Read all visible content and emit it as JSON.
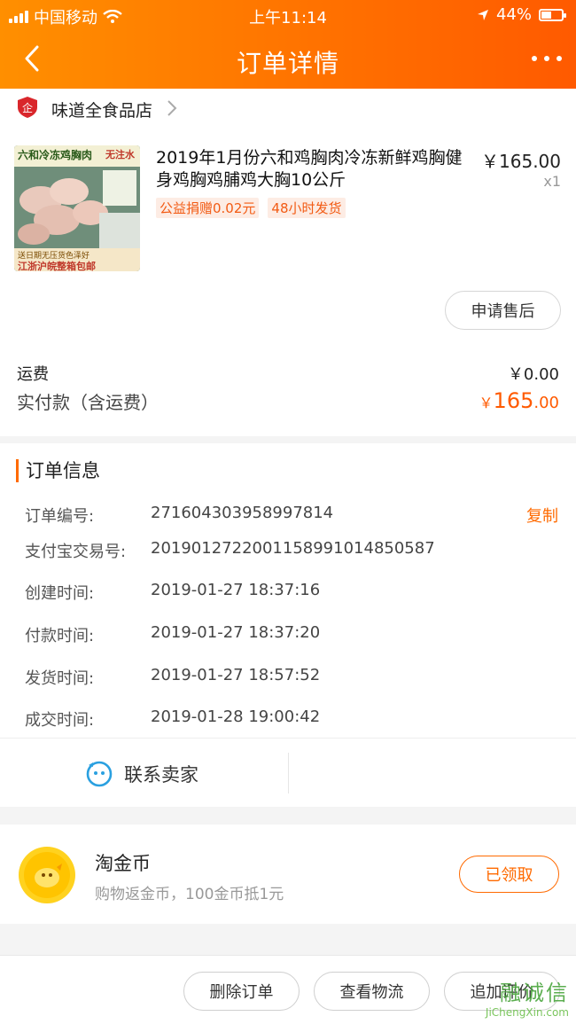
{
  "status_bar": {
    "carrier": "中国移动",
    "time": "上午11:14",
    "battery": "44%"
  },
  "nav": {
    "title": "订单详情"
  },
  "store": {
    "name": "味道全食品店"
  },
  "product": {
    "title": "2019年1月份六和鸡胸肉冷冻新鲜鸡胸健身鸡胸鸡脯鸡大胸10公斤",
    "price": "￥165.00",
    "quantity": "x1",
    "tags": [
      "公益捐赠0.02元",
      "48小时发货"
    ],
    "image_text": {
      "line1": "六和冷冻鸡胸肉",
      "line2": "无注水",
      "line3": "江浙沪皖整箱包邮",
      "line4": "送日期无压货色泽好"
    },
    "after_sale_button": "申请售后"
  },
  "fees": {
    "shipping_label": "运费",
    "shipping_value": "￥0.00",
    "paid_label": "实付款（含运费）",
    "paid_currency": "￥",
    "paid_main": "165",
    "paid_cents": ".00"
  },
  "order_info": {
    "heading": "订单信息",
    "copy_label": "复制",
    "rows": [
      {
        "key": "订单编号:",
        "value": "271604303958997814"
      },
      {
        "key": "支付宝交易号:",
        "value": "2019012722001158991014850587"
      },
      {
        "key": "创建时间:",
        "value": "2019-01-27 18:37:16"
      },
      {
        "key": "付款时间:",
        "value": "2019-01-27 18:37:20"
      },
      {
        "key": "发货时间:",
        "value": "2019-01-27 18:57:52"
      },
      {
        "key": "成交时间:",
        "value": "2019-01-28 19:00:42"
      }
    ]
  },
  "contact": {
    "label": "联系卖家"
  },
  "coins": {
    "title": "淘金币",
    "subtitle": "购物返金币，100金币抵1元",
    "button": "已领取"
  },
  "peek_text": "",
  "bottom_bar": {
    "delete": "删除订单",
    "logistics": "查看物流",
    "review": "追加评价"
  },
  "watermark": {
    "text": "JiChengXin.com",
    "brand": "融诚信"
  },
  "colors": {
    "accent": "#ff6a00",
    "header_start": "#ff8f00",
    "header_end": "#ff5a00"
  }
}
